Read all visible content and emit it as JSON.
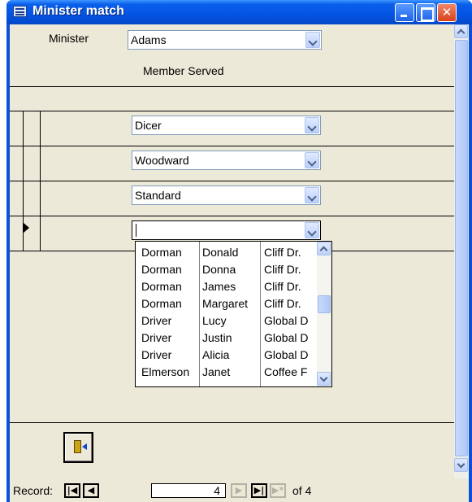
{
  "window": {
    "title": "Minister match"
  },
  "form": {
    "minister_label": "Minister",
    "minister_value": "Adams",
    "member_served_label": "Member Served",
    "rows": [
      {
        "value": "Dicer"
      },
      {
        "value": "Woodward"
      },
      {
        "value": "Standard"
      },
      {
        "value": ""
      }
    ]
  },
  "dropdown": {
    "items": [
      {
        "last": "Dorman",
        "first": "Donald",
        "address": "Cliff Dr."
      },
      {
        "last": "Dorman",
        "first": "Donna",
        "address": "Cliff Dr."
      },
      {
        "last": "Dorman",
        "first": "James",
        "address": "Cliff Dr."
      },
      {
        "last": "Dorman",
        "first": "Margaret",
        "address": "Cliff Dr."
      },
      {
        "last": "Driver",
        "first": "Lucy",
        "address": "Global D"
      },
      {
        "last": "Driver",
        "first": "Justin",
        "address": "Global D"
      },
      {
        "last": "Driver",
        "first": "Alicia",
        "address": "Global D"
      },
      {
        "last": "Elmerson",
        "first": "Janet",
        "address": "Coffee F"
      }
    ]
  },
  "navigation": {
    "record_label": "Record:",
    "current_record": "4",
    "of_label": "of 4"
  },
  "icons": {
    "app": "form-icon",
    "exit": "exit-door-icon"
  },
  "colors": {
    "titlebar": "#0454e4",
    "client_background": "#ece9d8"
  }
}
